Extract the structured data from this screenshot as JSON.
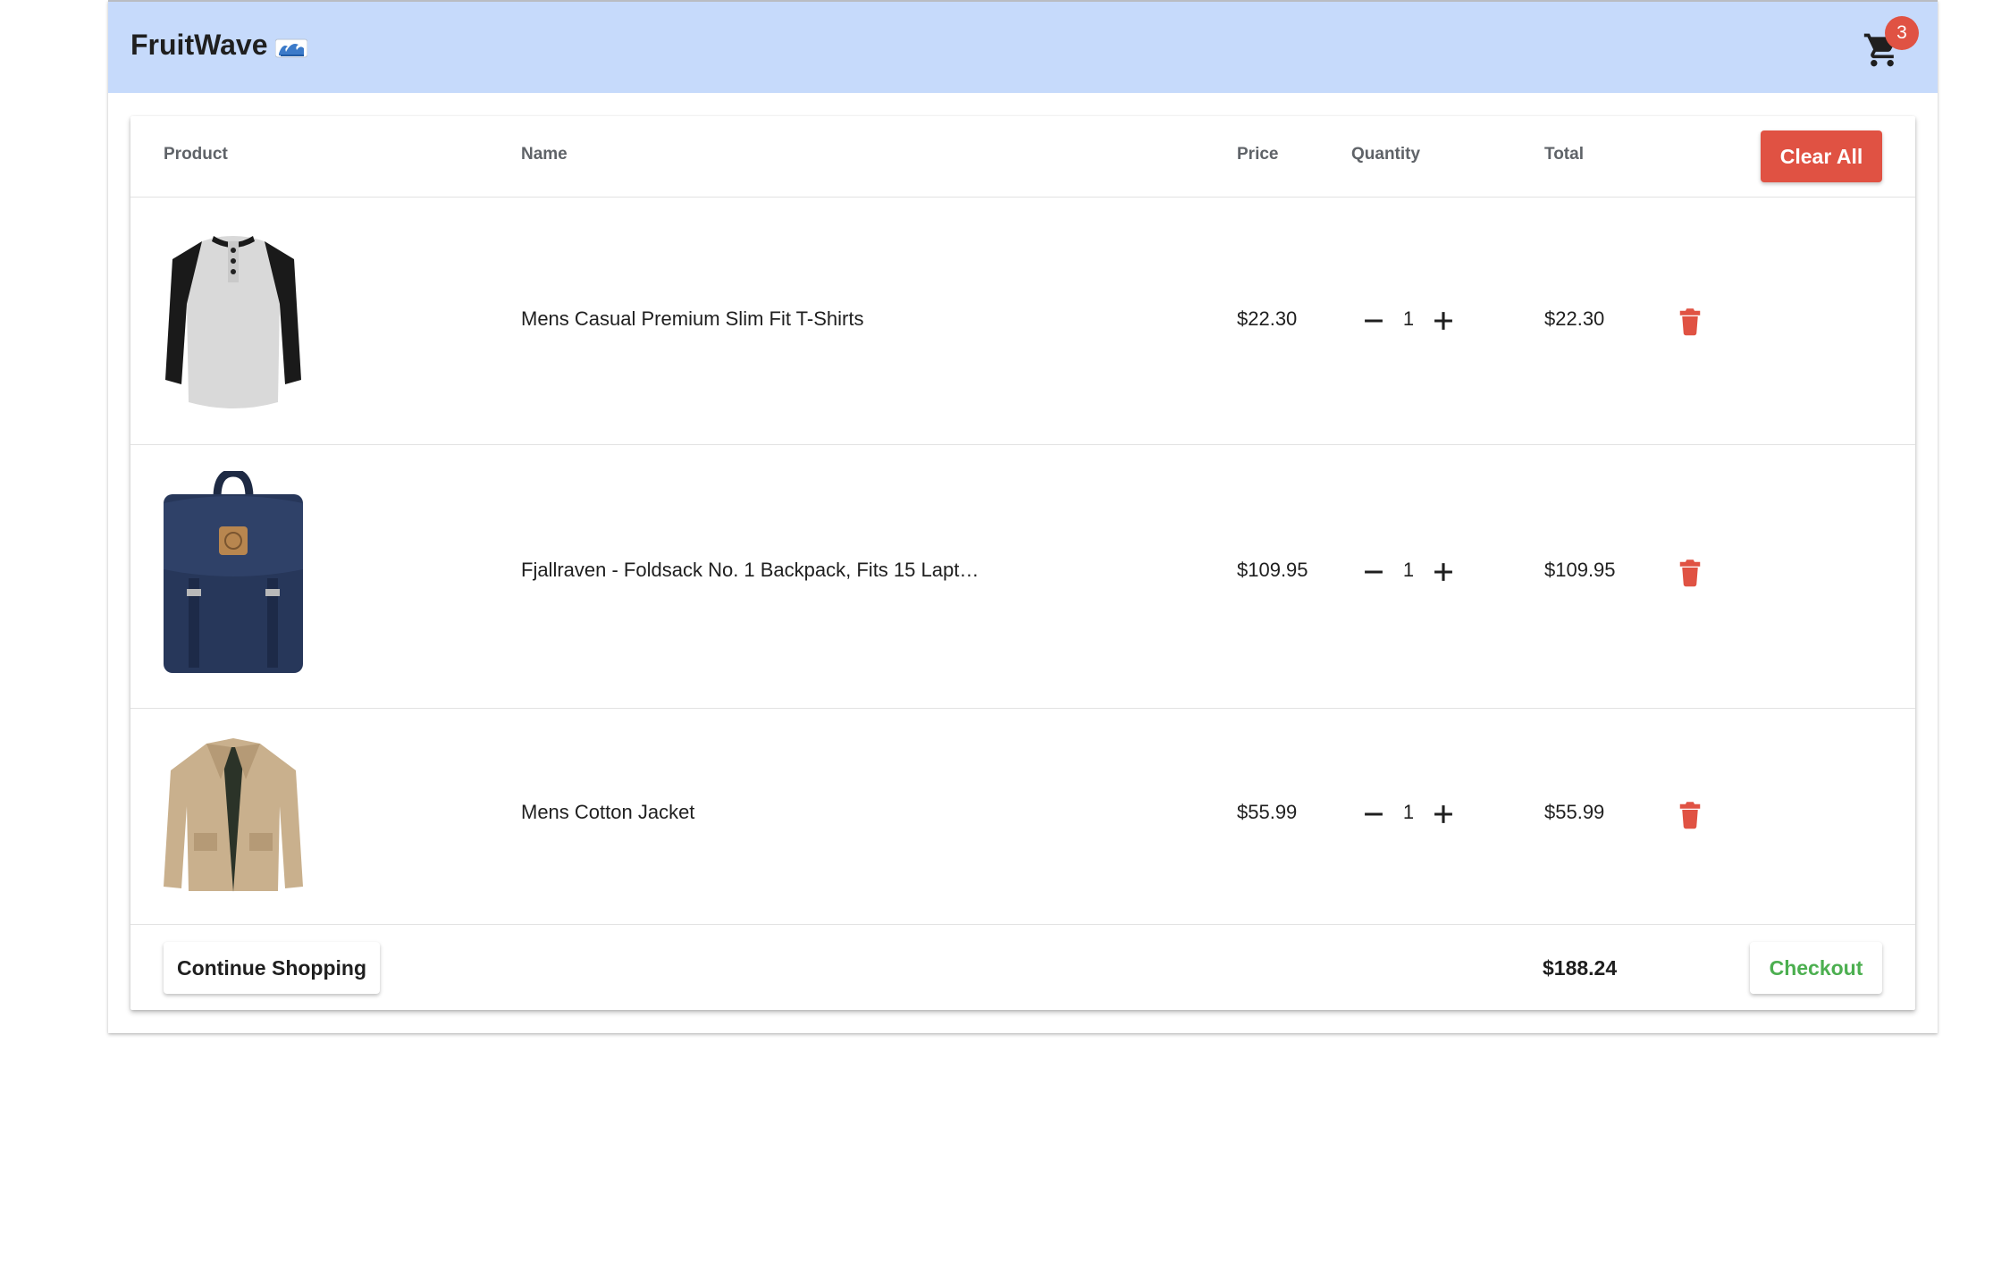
{
  "colors": {
    "appbar_bg": "#c6dafb",
    "accent_red": "#e05243",
    "checkout_green": "#4caf50",
    "text_dark": "#1f1f1f",
    "text_muted": "#5f6368"
  },
  "header": {
    "brand": "FruitWave",
    "brand_icon": "wave-icon",
    "cart_icon": "shopping-cart-icon",
    "cart_count": "3"
  },
  "table": {
    "columns": {
      "product": "Product",
      "name": "Name",
      "price": "Price",
      "quantity": "Quantity",
      "total": "Total"
    },
    "clear_all_label": "Clear All",
    "rows": [
      {
        "image_icon": "henley-shirt-image",
        "name": "Mens Casual Premium Slim Fit T-Shirts",
        "price": "$22.30",
        "quantity": "1",
        "total": "$22.30"
      },
      {
        "image_icon": "backpack-image",
        "name": "Fjallraven - Foldsack No. 1 Backpack, Fits 15 Lapt…",
        "price": "$109.95",
        "quantity": "1",
        "total": "$109.95"
      },
      {
        "image_icon": "jacket-image",
        "name": "Mens Cotton Jacket",
        "price": "$55.99",
        "quantity": "1",
        "total": "$55.99"
      }
    ]
  },
  "footer": {
    "continue_label": "Continue Shopping",
    "grand_total": "$188.24",
    "checkout_label": "Checkout"
  }
}
